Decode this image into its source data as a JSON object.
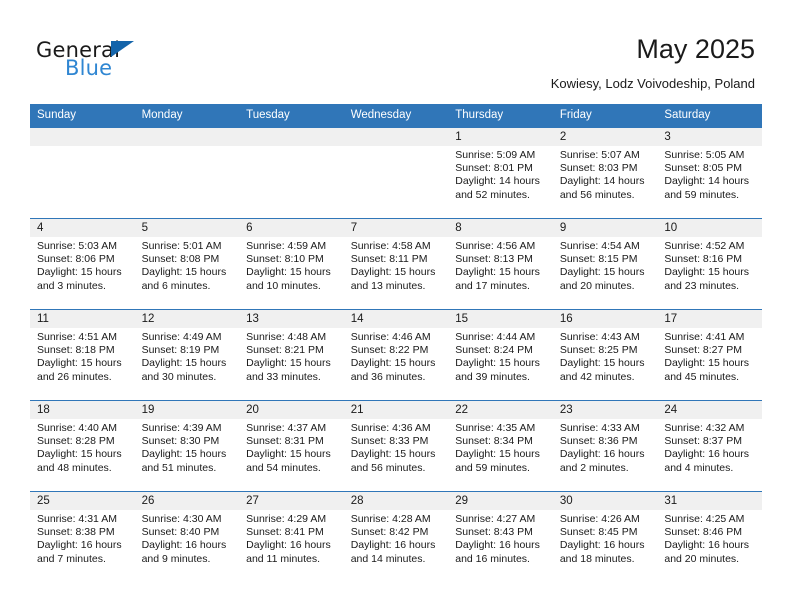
{
  "brand": {
    "word1": "General",
    "word2": "Blue",
    "triangle_color": "#1464aa",
    "blue_color": "#2f86d2"
  },
  "header": {
    "title": "May 2025",
    "location": "Kowiesy, Lodz Voivodeship, Poland"
  },
  "theme": {
    "header_row_bg": "#3076b8",
    "daynum_band_bg": "#f0f0f0",
    "grid_line": "#3076b8"
  },
  "weekdays": [
    "Sunday",
    "Monday",
    "Tuesday",
    "Wednesday",
    "Thursday",
    "Friday",
    "Saturday"
  ],
  "weeks": [
    [
      {
        "day": "",
        "lines": []
      },
      {
        "day": "",
        "lines": []
      },
      {
        "day": "",
        "lines": []
      },
      {
        "day": "",
        "lines": []
      },
      {
        "day": "1",
        "lines": [
          "Sunrise: 5:09 AM",
          "Sunset: 8:01 PM",
          "Daylight: 14 hours",
          "and 52 minutes."
        ]
      },
      {
        "day": "2",
        "lines": [
          "Sunrise: 5:07 AM",
          "Sunset: 8:03 PM",
          "Daylight: 14 hours",
          "and 56 minutes."
        ]
      },
      {
        "day": "3",
        "lines": [
          "Sunrise: 5:05 AM",
          "Sunset: 8:05 PM",
          "Daylight: 14 hours",
          "and 59 minutes."
        ]
      }
    ],
    [
      {
        "day": "4",
        "lines": [
          "Sunrise: 5:03 AM",
          "Sunset: 8:06 PM",
          "Daylight: 15 hours",
          "and 3 minutes."
        ]
      },
      {
        "day": "5",
        "lines": [
          "Sunrise: 5:01 AM",
          "Sunset: 8:08 PM",
          "Daylight: 15 hours",
          "and 6 minutes."
        ]
      },
      {
        "day": "6",
        "lines": [
          "Sunrise: 4:59 AM",
          "Sunset: 8:10 PM",
          "Daylight: 15 hours",
          "and 10 minutes."
        ]
      },
      {
        "day": "7",
        "lines": [
          "Sunrise: 4:58 AM",
          "Sunset: 8:11 PM",
          "Daylight: 15 hours",
          "and 13 minutes."
        ]
      },
      {
        "day": "8",
        "lines": [
          "Sunrise: 4:56 AM",
          "Sunset: 8:13 PM",
          "Daylight: 15 hours",
          "and 17 minutes."
        ]
      },
      {
        "day": "9",
        "lines": [
          "Sunrise: 4:54 AM",
          "Sunset: 8:15 PM",
          "Daylight: 15 hours",
          "and 20 minutes."
        ]
      },
      {
        "day": "10",
        "lines": [
          "Sunrise: 4:52 AM",
          "Sunset: 8:16 PM",
          "Daylight: 15 hours",
          "and 23 minutes."
        ]
      }
    ],
    [
      {
        "day": "11",
        "lines": [
          "Sunrise: 4:51 AM",
          "Sunset: 8:18 PM",
          "Daylight: 15 hours",
          "and 26 minutes."
        ]
      },
      {
        "day": "12",
        "lines": [
          "Sunrise: 4:49 AM",
          "Sunset: 8:19 PM",
          "Daylight: 15 hours",
          "and 30 minutes."
        ]
      },
      {
        "day": "13",
        "lines": [
          "Sunrise: 4:48 AM",
          "Sunset: 8:21 PM",
          "Daylight: 15 hours",
          "and 33 minutes."
        ]
      },
      {
        "day": "14",
        "lines": [
          "Sunrise: 4:46 AM",
          "Sunset: 8:22 PM",
          "Daylight: 15 hours",
          "and 36 minutes."
        ]
      },
      {
        "day": "15",
        "lines": [
          "Sunrise: 4:44 AM",
          "Sunset: 8:24 PM",
          "Daylight: 15 hours",
          "and 39 minutes."
        ]
      },
      {
        "day": "16",
        "lines": [
          "Sunrise: 4:43 AM",
          "Sunset: 8:25 PM",
          "Daylight: 15 hours",
          "and 42 minutes."
        ]
      },
      {
        "day": "17",
        "lines": [
          "Sunrise: 4:41 AM",
          "Sunset: 8:27 PM",
          "Daylight: 15 hours",
          "and 45 minutes."
        ]
      }
    ],
    [
      {
        "day": "18",
        "lines": [
          "Sunrise: 4:40 AM",
          "Sunset: 8:28 PM",
          "Daylight: 15 hours",
          "and 48 minutes."
        ]
      },
      {
        "day": "19",
        "lines": [
          "Sunrise: 4:39 AM",
          "Sunset: 8:30 PM",
          "Daylight: 15 hours",
          "and 51 minutes."
        ]
      },
      {
        "day": "20",
        "lines": [
          "Sunrise: 4:37 AM",
          "Sunset: 8:31 PM",
          "Daylight: 15 hours",
          "and 54 minutes."
        ]
      },
      {
        "day": "21",
        "lines": [
          "Sunrise: 4:36 AM",
          "Sunset: 8:33 PM",
          "Daylight: 15 hours",
          "and 56 minutes."
        ]
      },
      {
        "day": "22",
        "lines": [
          "Sunrise: 4:35 AM",
          "Sunset: 8:34 PM",
          "Daylight: 15 hours",
          "and 59 minutes."
        ]
      },
      {
        "day": "23",
        "lines": [
          "Sunrise: 4:33 AM",
          "Sunset: 8:36 PM",
          "Daylight: 16 hours",
          "and 2 minutes."
        ]
      },
      {
        "day": "24",
        "lines": [
          "Sunrise: 4:32 AM",
          "Sunset: 8:37 PM",
          "Daylight: 16 hours",
          "and 4 minutes."
        ]
      }
    ],
    [
      {
        "day": "25",
        "lines": [
          "Sunrise: 4:31 AM",
          "Sunset: 8:38 PM",
          "Daylight: 16 hours",
          "and 7 minutes."
        ]
      },
      {
        "day": "26",
        "lines": [
          "Sunrise: 4:30 AM",
          "Sunset: 8:40 PM",
          "Daylight: 16 hours",
          "and 9 minutes."
        ]
      },
      {
        "day": "27",
        "lines": [
          "Sunrise: 4:29 AM",
          "Sunset: 8:41 PM",
          "Daylight: 16 hours",
          "and 11 minutes."
        ]
      },
      {
        "day": "28",
        "lines": [
          "Sunrise: 4:28 AM",
          "Sunset: 8:42 PM",
          "Daylight: 16 hours",
          "and 14 minutes."
        ]
      },
      {
        "day": "29",
        "lines": [
          "Sunrise: 4:27 AM",
          "Sunset: 8:43 PM",
          "Daylight: 16 hours",
          "and 16 minutes."
        ]
      },
      {
        "day": "30",
        "lines": [
          "Sunrise: 4:26 AM",
          "Sunset: 8:45 PM",
          "Daylight: 16 hours",
          "and 18 minutes."
        ]
      },
      {
        "day": "31",
        "lines": [
          "Sunrise: 4:25 AM",
          "Sunset: 8:46 PM",
          "Daylight: 16 hours",
          "and 20 minutes."
        ]
      }
    ]
  ]
}
